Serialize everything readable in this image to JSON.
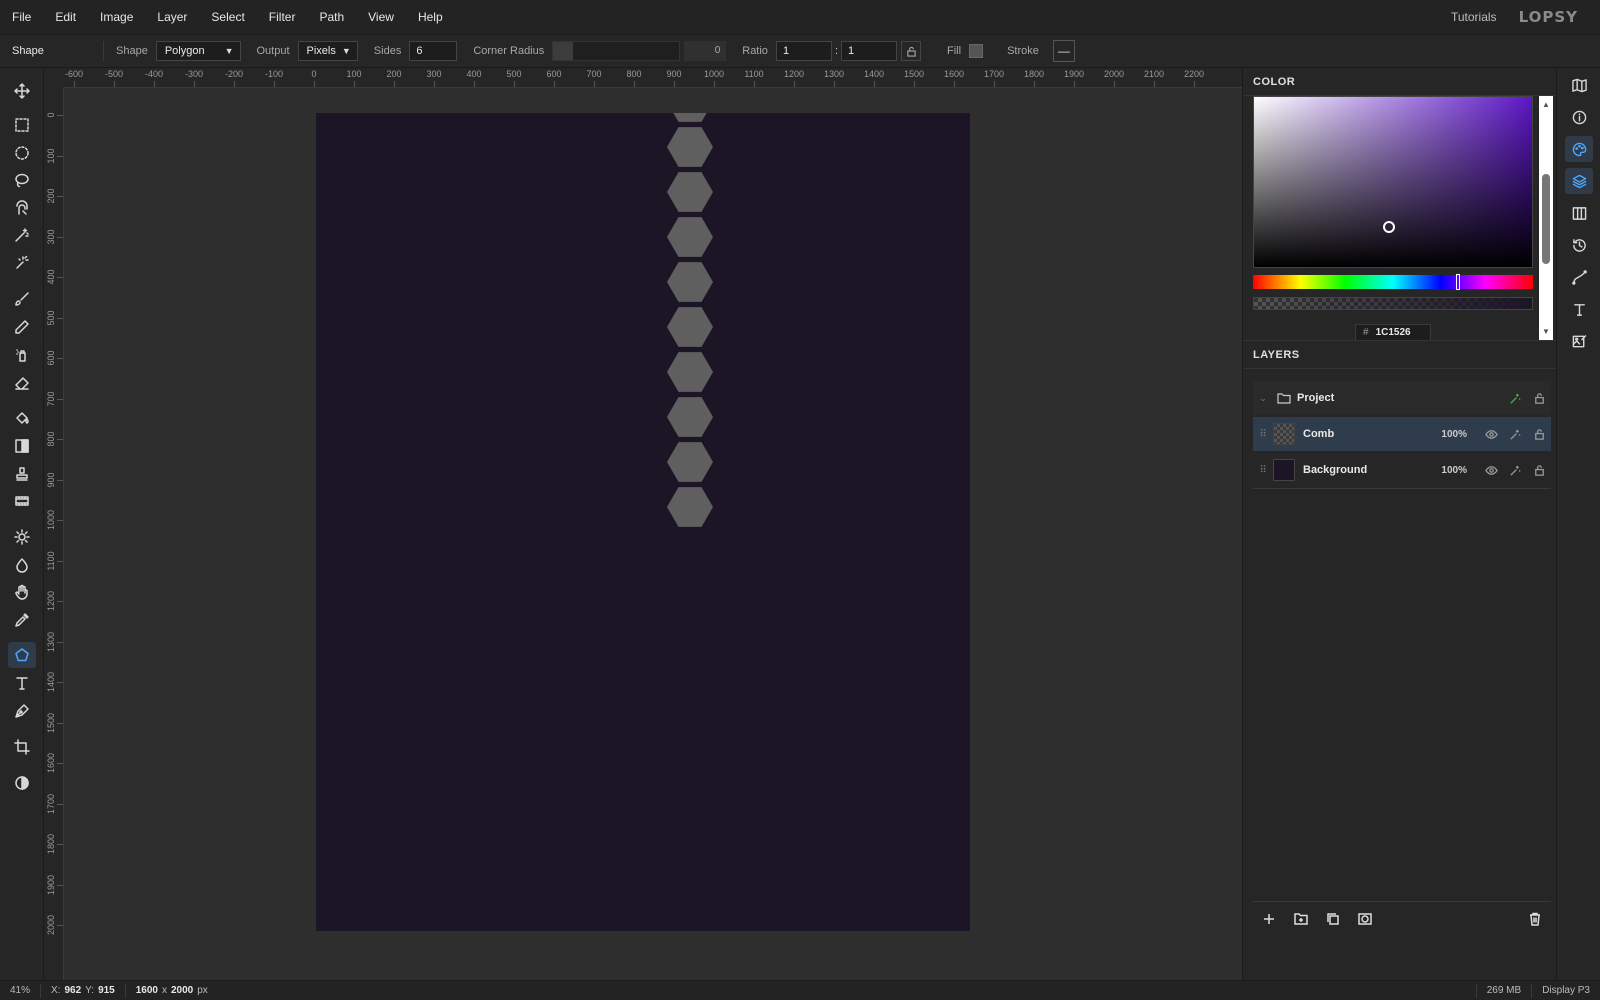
{
  "menu": [
    "File",
    "Edit",
    "Image",
    "Layer",
    "Select",
    "Filter",
    "Path",
    "View",
    "Help"
  ],
  "header": {
    "tutorials": "Tutorials",
    "logo": "LOPSY"
  },
  "options": {
    "tool_name": "Shape",
    "shape_label": "Shape",
    "shape_value": "Polygon",
    "output_label": "Output",
    "output_value": "Pixels",
    "sides_label": "Sides",
    "sides_value": "6",
    "corner_label": "Corner Radius",
    "corner_value": "0",
    "ratio_label": "Ratio",
    "ratio_a": "1",
    "ratio_sep": ":",
    "ratio_b": "1",
    "fill_label": "Fill",
    "stroke_label": "Stroke",
    "stroke_value": "—"
  },
  "ruler_h": [
    "-600",
    "-500",
    "-400",
    "-300",
    "-200",
    "-100",
    "0",
    "100",
    "200",
    "300",
    "400",
    "500",
    "600",
    "700",
    "800",
    "900",
    "1000",
    "1100",
    "1200",
    "1300",
    "1400",
    "1500",
    "1600",
    "1700",
    "1800",
    "1900",
    "2000",
    "2100",
    "2200"
  ],
  "ruler_v": [
    "0",
    "100",
    "200",
    "300",
    "400",
    "500",
    "600",
    "700",
    "800",
    "900",
    "1000",
    "1100",
    "1200",
    "1300",
    "1400",
    "1500",
    "1600",
    "1700",
    "1800",
    "1900",
    "2000"
  ],
  "canvas": {
    "background_color": "#1C1526",
    "hexagon_color": "#5f5f5f",
    "hexagon_count": 9
  },
  "color_panel": {
    "title": "COLOR",
    "hex_value": "1C1526",
    "hue_fraction": 0.735,
    "saturation_fraction": 0.47,
    "value_fraction": 0.26
  },
  "layers_panel": {
    "title": "LAYERS",
    "project": {
      "name": "Project"
    },
    "layers": [
      {
        "name": "Comb",
        "opacity": "100%",
        "selected": true
      },
      {
        "name": "Background",
        "opacity": "100%",
        "selected": false
      }
    ]
  },
  "status": {
    "zoom": "41%",
    "x_label": "X:",
    "x_value": "962",
    "y_label": "Y:",
    "y_value": "915",
    "doc_w": "1600",
    "doc_sep": "x",
    "doc_h": "2000",
    "doc_unit": "px",
    "memory": "269 MB",
    "color_profile": "Display P3"
  },
  "tools": [
    "move-icon",
    "rect-select-icon",
    "ellipse-select-icon",
    "lasso-icon",
    "magnetic-lasso-icon",
    "magic-wand-icon",
    "quick-select-icon",
    "brush-icon",
    "pencil-icon",
    "spray-icon",
    "eraser-icon",
    "paint-bucket-icon",
    "gradient-icon",
    "stamp-icon",
    "film-icon",
    "sun-icon",
    "droplet-icon",
    "hand-icon",
    "eyedropper-icon",
    "polygon-icon",
    "text-icon",
    "pen-icon",
    "crop-icon",
    "contrast-icon"
  ],
  "strip": [
    "map-icon",
    "info-icon",
    "palette-icon",
    "layers-icon",
    "columns-icon",
    "history-icon",
    "path-icon",
    "type-icon",
    "image-edit-icon"
  ]
}
